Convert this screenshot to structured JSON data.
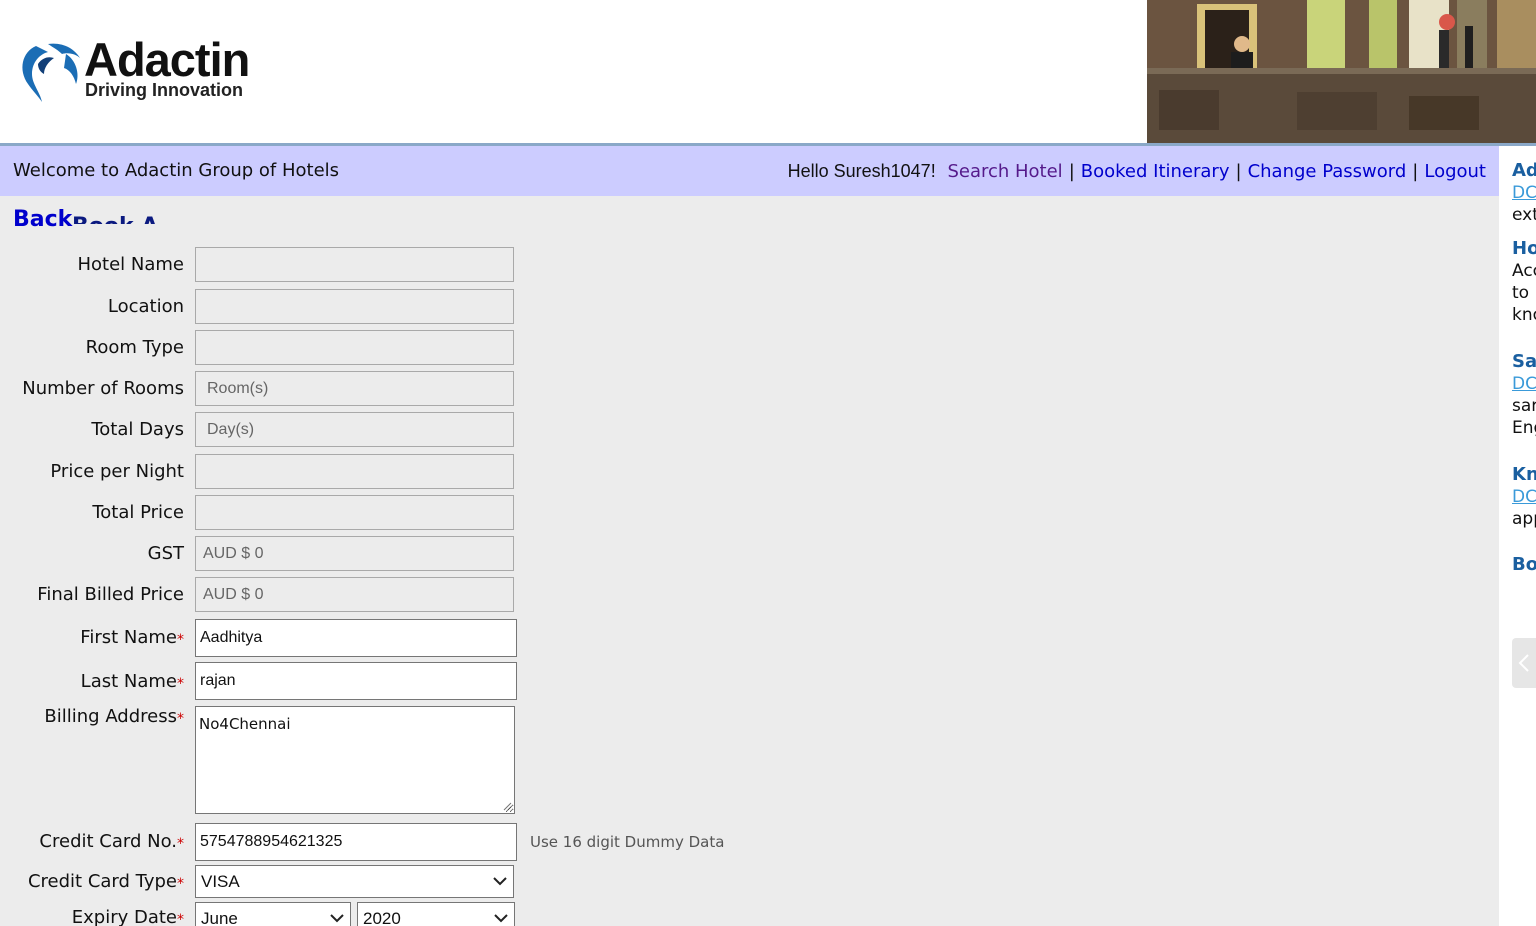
{
  "brand": {
    "name": "Adactin",
    "tagline": "Driving Innovation"
  },
  "nav": {
    "welcome": "Welcome to Adactin Group of Hotels",
    "greeting": "Hello Suresh1047!",
    "links": [
      "Search Hotel",
      "Booked Itinerary",
      "Change Password",
      "Logout"
    ],
    "separator": "|"
  },
  "page": {
    "back_label": "Back",
    "heading_partial": "Book A Hotel"
  },
  "form": {
    "hotel_name": {
      "label": "Hotel Name",
      "value": ""
    },
    "location": {
      "label": "Location",
      "value": ""
    },
    "room_type": {
      "label": "Room Type",
      "value": ""
    },
    "num_rooms": {
      "label": "Number of Rooms",
      "value": "Room(s)"
    },
    "total_days": {
      "label": "Total Days",
      "value": "Day(s)"
    },
    "price_night": {
      "label": "Price per Night",
      "value": ""
    },
    "total_price": {
      "label": "Total Price",
      "value": ""
    },
    "gst": {
      "label": "GST",
      "value": "AUD $ 0"
    },
    "final_price": {
      "label": "Final Billed Price",
      "value": "AUD $ 0"
    },
    "first_name": {
      "label": "First Name",
      "value": "Aadhitya"
    },
    "last_name": {
      "label": "Last Name",
      "value": "rajan"
    },
    "address": {
      "label": "Billing Address",
      "value": "No4Chennai"
    },
    "cc_no": {
      "label": "Credit Card No.",
      "value": "5754788954621325",
      "hint": "Use 16 digit Dummy Data"
    },
    "cc_type": {
      "label": "Credit Card Type",
      "value": "VISA"
    },
    "expiry": {
      "label": "Expiry Date",
      "month": "June",
      "year": "2020"
    },
    "required_mark": "*"
  },
  "sidebar": {
    "sections": [
      {
        "title": "Ad",
        "link": "DC",
        "text": [
          "ext"
        ]
      },
      {
        "title": "Ho",
        "text": [
          "Acc",
          "to",
          "kno"
        ]
      },
      {
        "title": "Sa",
        "link": "DC",
        "text": [
          "sar",
          "Eng"
        ]
      },
      {
        "title": "Kn",
        "link": "DC",
        "text": [
          "app"
        ]
      },
      {
        "title": "Bo"
      }
    ]
  },
  "icons": {
    "logo_mark": "adactin-swirl-logo",
    "photo": "hotel-reception-photo",
    "dropdown": "chevron-down-icon",
    "collapse": "chevron-left-icon"
  },
  "colors": {
    "navbar_bg": "#ccccff",
    "link": "#0000cc",
    "visited": "#551a8b",
    "required": "#cc0000",
    "sidebar_heading": "#1a5fa0"
  }
}
